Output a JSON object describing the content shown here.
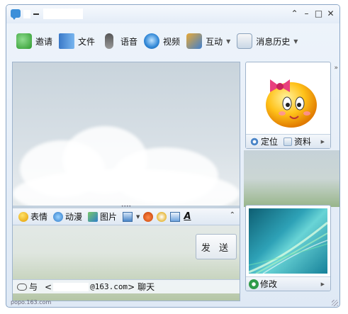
{
  "window": {
    "title_separator": "–",
    "controls": {
      "collapse": "⌃",
      "minimize": "–",
      "maximize": "□",
      "close": "✕"
    }
  },
  "toolbar": {
    "items": [
      {
        "label": "邀请",
        "icon": "invite-icon"
      },
      {
        "label": "文件",
        "icon": "file-icon"
      },
      {
        "label": "语音",
        "icon": "microphone-icon"
      },
      {
        "label": "视频",
        "icon": "webcam-icon"
      },
      {
        "label": "互动",
        "icon": "interact-icon",
        "has_dropdown": true
      },
      {
        "label": "消息历史",
        "icon": "history-icon",
        "has_dropdown": true
      }
    ],
    "dropdown_glyph": "▼",
    "expand_glyph": "»"
  },
  "format_bar": {
    "items": [
      {
        "label": "表情",
        "icon": "smiley-icon"
      },
      {
        "label": "动漫",
        "icon": "animation-icon"
      },
      {
        "label": "图片",
        "icon": "picture-icon"
      }
    ],
    "font_label": "A",
    "collapse_glyph": "⌃"
  },
  "send_button": {
    "label": "发 送"
  },
  "status_bar": {
    "prefix": "与",
    "email_open": "<",
    "email_visible": "@163.com",
    "email_close": ">",
    "suffix": "聊天"
  },
  "avatar_panel": {
    "locate_label": "定位",
    "info_label": "资料",
    "arrow": "▶"
  },
  "preview_panel": {
    "edit_label": "修改",
    "arrow": "▶"
  },
  "footer": {
    "text": "popo.163.com"
  },
  "colors": {
    "accent": "#3b8fd9",
    "window_border": "#8aa6c6",
    "bar_gradient_top": "#f4f7fb",
    "bar_gradient_bottom": "#dde6f1"
  }
}
